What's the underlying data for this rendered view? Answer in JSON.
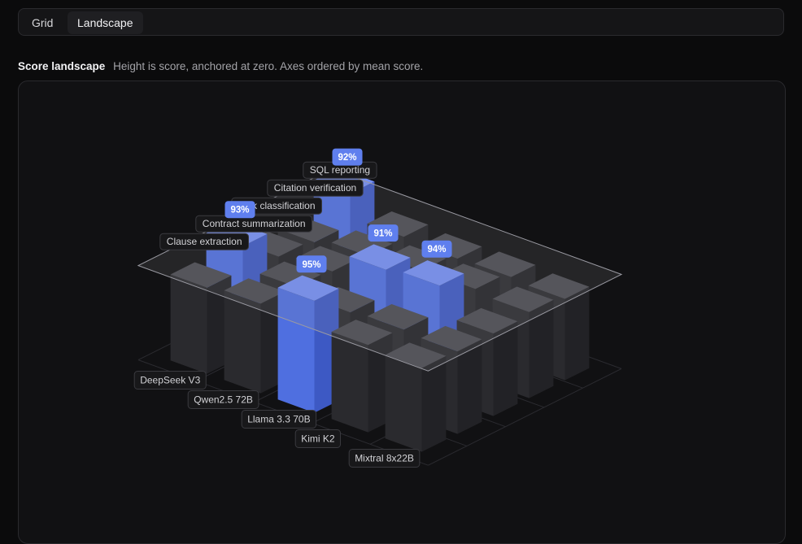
{
  "tabs": [
    {
      "label": "Grid",
      "active": false
    },
    {
      "label": "Landscape",
      "active": true
    }
  ],
  "section": {
    "title": "Score landscape",
    "subtitle": "Height is score, anchored at zero. Axes ordered by mean score."
  },
  "colors": {
    "highlight": "#5f7fee",
    "bar": "#3a3a3e",
    "background": "#111113"
  },
  "chart_data": {
    "type": "bar3d",
    "rows": [
      "Clause extraction",
      "Contract summarization",
      "Risk classification",
      "Citation verification",
      "SQL reporting"
    ],
    "columns": [
      "DeepSeek V3",
      "Qwen2.5 72B",
      "Llama 3.3 70B",
      "Kimi K2",
      "Mixtral 8x22B"
    ],
    "values": [
      [
        73,
        76,
        95,
        74,
        71
      ],
      [
        93,
        75,
        70,
        72,
        70
      ],
      [
        69,
        73,
        91,
        94,
        70
      ],
      [
        66,
        71,
        75,
        76,
        73
      ],
      [
        92,
        72,
        70,
        71,
        69
      ]
    ],
    "highlight_labels": [
      {
        "row": 4,
        "col": 0,
        "label": "92%"
      },
      {
        "row": 1,
        "col": 0,
        "label": "93%"
      },
      {
        "row": 0,
        "col": 2,
        "label": "95%"
      },
      {
        "row": 2,
        "col": 2,
        "label": "91%"
      },
      {
        "row": 2,
        "col": 3,
        "label": "94%"
      }
    ],
    "zmin": 0,
    "zmax": 100,
    "plane": 80
  }
}
